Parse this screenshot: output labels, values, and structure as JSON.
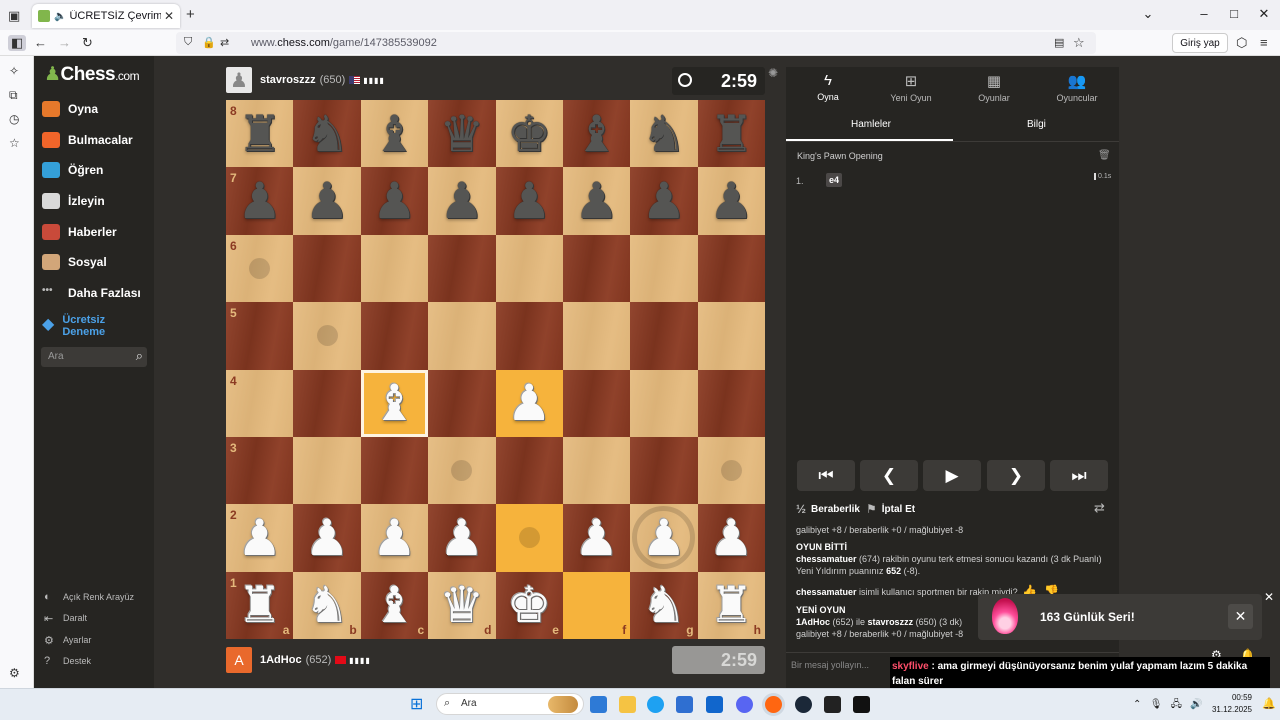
{
  "browser": {
    "tab_title": "ÜCRETSİZ Çevrimiçi Satranç",
    "url_prefix": "www.",
    "url_domain": "chess.com",
    "url_path": "/game/147385539092",
    "login_label": "Giriş yap"
  },
  "sidebar": {
    "logo": "Chess",
    "logo_suffix": ".com",
    "items": [
      {
        "label": "Oyna",
        "icon": "pawn-hand-icon",
        "color": "#e6792b"
      },
      {
        "label": "Bulmacalar",
        "icon": "puzzle-icon",
        "color": "#f0652a"
      },
      {
        "label": "Öğren",
        "icon": "learn-cube-icon",
        "color": "#34a0d9"
      },
      {
        "label": "İzleyin",
        "icon": "binoculars-icon",
        "color": "#d9d9d9"
      },
      {
        "label": "Haberler",
        "icon": "newspaper-icon",
        "color": "#c94a3a"
      },
      {
        "label": "Sosyal",
        "icon": "social-icon",
        "color": "#d2a679"
      },
      {
        "label": "Daha Fazlası",
        "icon": "more-dots-icon",
        "color": "#bababa"
      }
    ],
    "trial_line1": "Ücretsiz",
    "trial_line2": "Deneme",
    "search_placeholder": "Ara",
    "bottom": [
      {
        "label": "Açık Renk Arayüz",
        "icon": "theme-toggle-icon"
      },
      {
        "label": "Daralt",
        "icon": "collapse-icon"
      },
      {
        "label": "Ayarlar",
        "icon": "settings-icon"
      },
      {
        "label": "Destek",
        "icon": "help-icon"
      }
    ]
  },
  "top_player": {
    "name": "stavroszzz",
    "rating": "(650)",
    "clock": "2:59"
  },
  "bottom_player": {
    "name": "1AdHoc",
    "rating": "(652)",
    "clock": "2:59",
    "avatar_letter": "A"
  },
  "board": {
    "ranks": [
      "8",
      "7",
      "6",
      "5",
      "4",
      "3",
      "2",
      "1"
    ],
    "files": [
      "a",
      "b",
      "c",
      "d",
      "e",
      "f",
      "g",
      "h"
    ],
    "light_color": "#e4b97c",
    "dark_color": "#8b3a22",
    "highlight_color": "#f6b33c",
    "pieces": [
      {
        "sq": "a8",
        "p": "♜",
        "c": "b"
      },
      {
        "sq": "b8",
        "p": "♞",
        "c": "b"
      },
      {
        "sq": "c8",
        "p": "♝",
        "c": "b"
      },
      {
        "sq": "d8",
        "p": "♛",
        "c": "b"
      },
      {
        "sq": "e8",
        "p": "♚",
        "c": "b"
      },
      {
        "sq": "f8",
        "p": "♝",
        "c": "b"
      },
      {
        "sq": "g8",
        "p": "♞",
        "c": "b"
      },
      {
        "sq": "h8",
        "p": "♜",
        "c": "b"
      },
      {
        "sq": "a7",
        "p": "♟",
        "c": "b"
      },
      {
        "sq": "b7",
        "p": "♟",
        "c": "b"
      },
      {
        "sq": "c7",
        "p": "♟",
        "c": "b"
      },
      {
        "sq": "d7",
        "p": "♟",
        "c": "b"
      },
      {
        "sq": "e7",
        "p": "♟",
        "c": "b"
      },
      {
        "sq": "f7",
        "p": "♟",
        "c": "b"
      },
      {
        "sq": "g7",
        "p": "♟",
        "c": "b"
      },
      {
        "sq": "h7",
        "p": "♟",
        "c": "b"
      },
      {
        "sq": "c4",
        "p": "♝",
        "c": "w"
      },
      {
        "sq": "e4",
        "p": "♟",
        "c": "w"
      },
      {
        "sq": "a2",
        "p": "♟",
        "c": "w"
      },
      {
        "sq": "b2",
        "p": "♟",
        "c": "w"
      },
      {
        "sq": "c2",
        "p": "♟",
        "c": "w"
      },
      {
        "sq": "d2",
        "p": "♟",
        "c": "w"
      },
      {
        "sq": "f2",
        "p": "♟",
        "c": "w"
      },
      {
        "sq": "g2",
        "p": "♟",
        "c": "w"
      },
      {
        "sq": "h2",
        "p": "♟",
        "c": "w"
      },
      {
        "sq": "a1",
        "p": "♜",
        "c": "w"
      },
      {
        "sq": "b1",
        "p": "♞",
        "c": "w"
      },
      {
        "sq": "c1",
        "p": "♝",
        "c": "w"
      },
      {
        "sq": "d1",
        "p": "♛",
        "c": "w"
      },
      {
        "sq": "e1",
        "p": "♚",
        "c": "w"
      },
      {
        "sq": "g1",
        "p": "♞",
        "c": "w"
      },
      {
        "sq": "h1",
        "p": "♜",
        "c": "w"
      }
    ],
    "highlighted": [
      "e4",
      "e2",
      "f1"
    ],
    "selected": "c4",
    "hints": [
      "a6",
      "b5",
      "d3",
      "h3",
      "e2"
    ],
    "ring_hints": [
      "g2"
    ]
  },
  "panel": {
    "tabs": [
      {
        "label": "Oyna",
        "icon": "lightning-icon"
      },
      {
        "label": "Yeni Oyun",
        "icon": "plus-square-icon"
      },
      {
        "label": "Oyunlar",
        "icon": "chessboard-icon"
      },
      {
        "label": "Oyuncular",
        "icon": "players-icon"
      }
    ],
    "subtab_moves": "Hamleler",
    "subtab_info": "Bilgi",
    "opening": "King's Pawn Opening",
    "move_number": "1.",
    "move_white": "e4",
    "move_time": "0.1s",
    "draw_label": "Beraberlik",
    "abort_label": "İptal Et",
    "message_placeholder": "Bir mesaj yollayın..."
  },
  "chat": {
    "line1": "galibiyet +8 / beraberlik +0 / mağlubiyet -8",
    "game_over": "OYUN BİTTİ",
    "result_name": "chessamatuer",
    "result_text": " (674) rakibin oyunu terk etmesi sonucu kazandı (3 dk Puanlı)",
    "new_rating_text": "Yeni Yıldırım puanınız ",
    "new_rating_val": "652",
    "new_rating_delta": " (-8).",
    "sportsman_name": "chessamatuer",
    "sportsman_text": " isimli kullanıcı sportmen bir rakip miydi?",
    "new_game": "YENİ OYUN",
    "ng_p1": "1AdHoc",
    "ng_mid": " (652) ile ",
    "ng_p2": "stavroszzz",
    "ng_end": " (650) (3 dk)",
    "line_last": "galibiyet +8 / beraberlik +0 / mağlubiyet -8"
  },
  "streak": {
    "text": "163 Günlük Seri!"
  },
  "overlay": {
    "name": "skyflive",
    "text": " : ama girmeyi düşünüyorsanız benim yulaf yapmam lazım 5 dakika falan sürer"
  },
  "taskbar": {
    "search": "Ara",
    "time": "00:59",
    "date": "31.12.2025"
  }
}
